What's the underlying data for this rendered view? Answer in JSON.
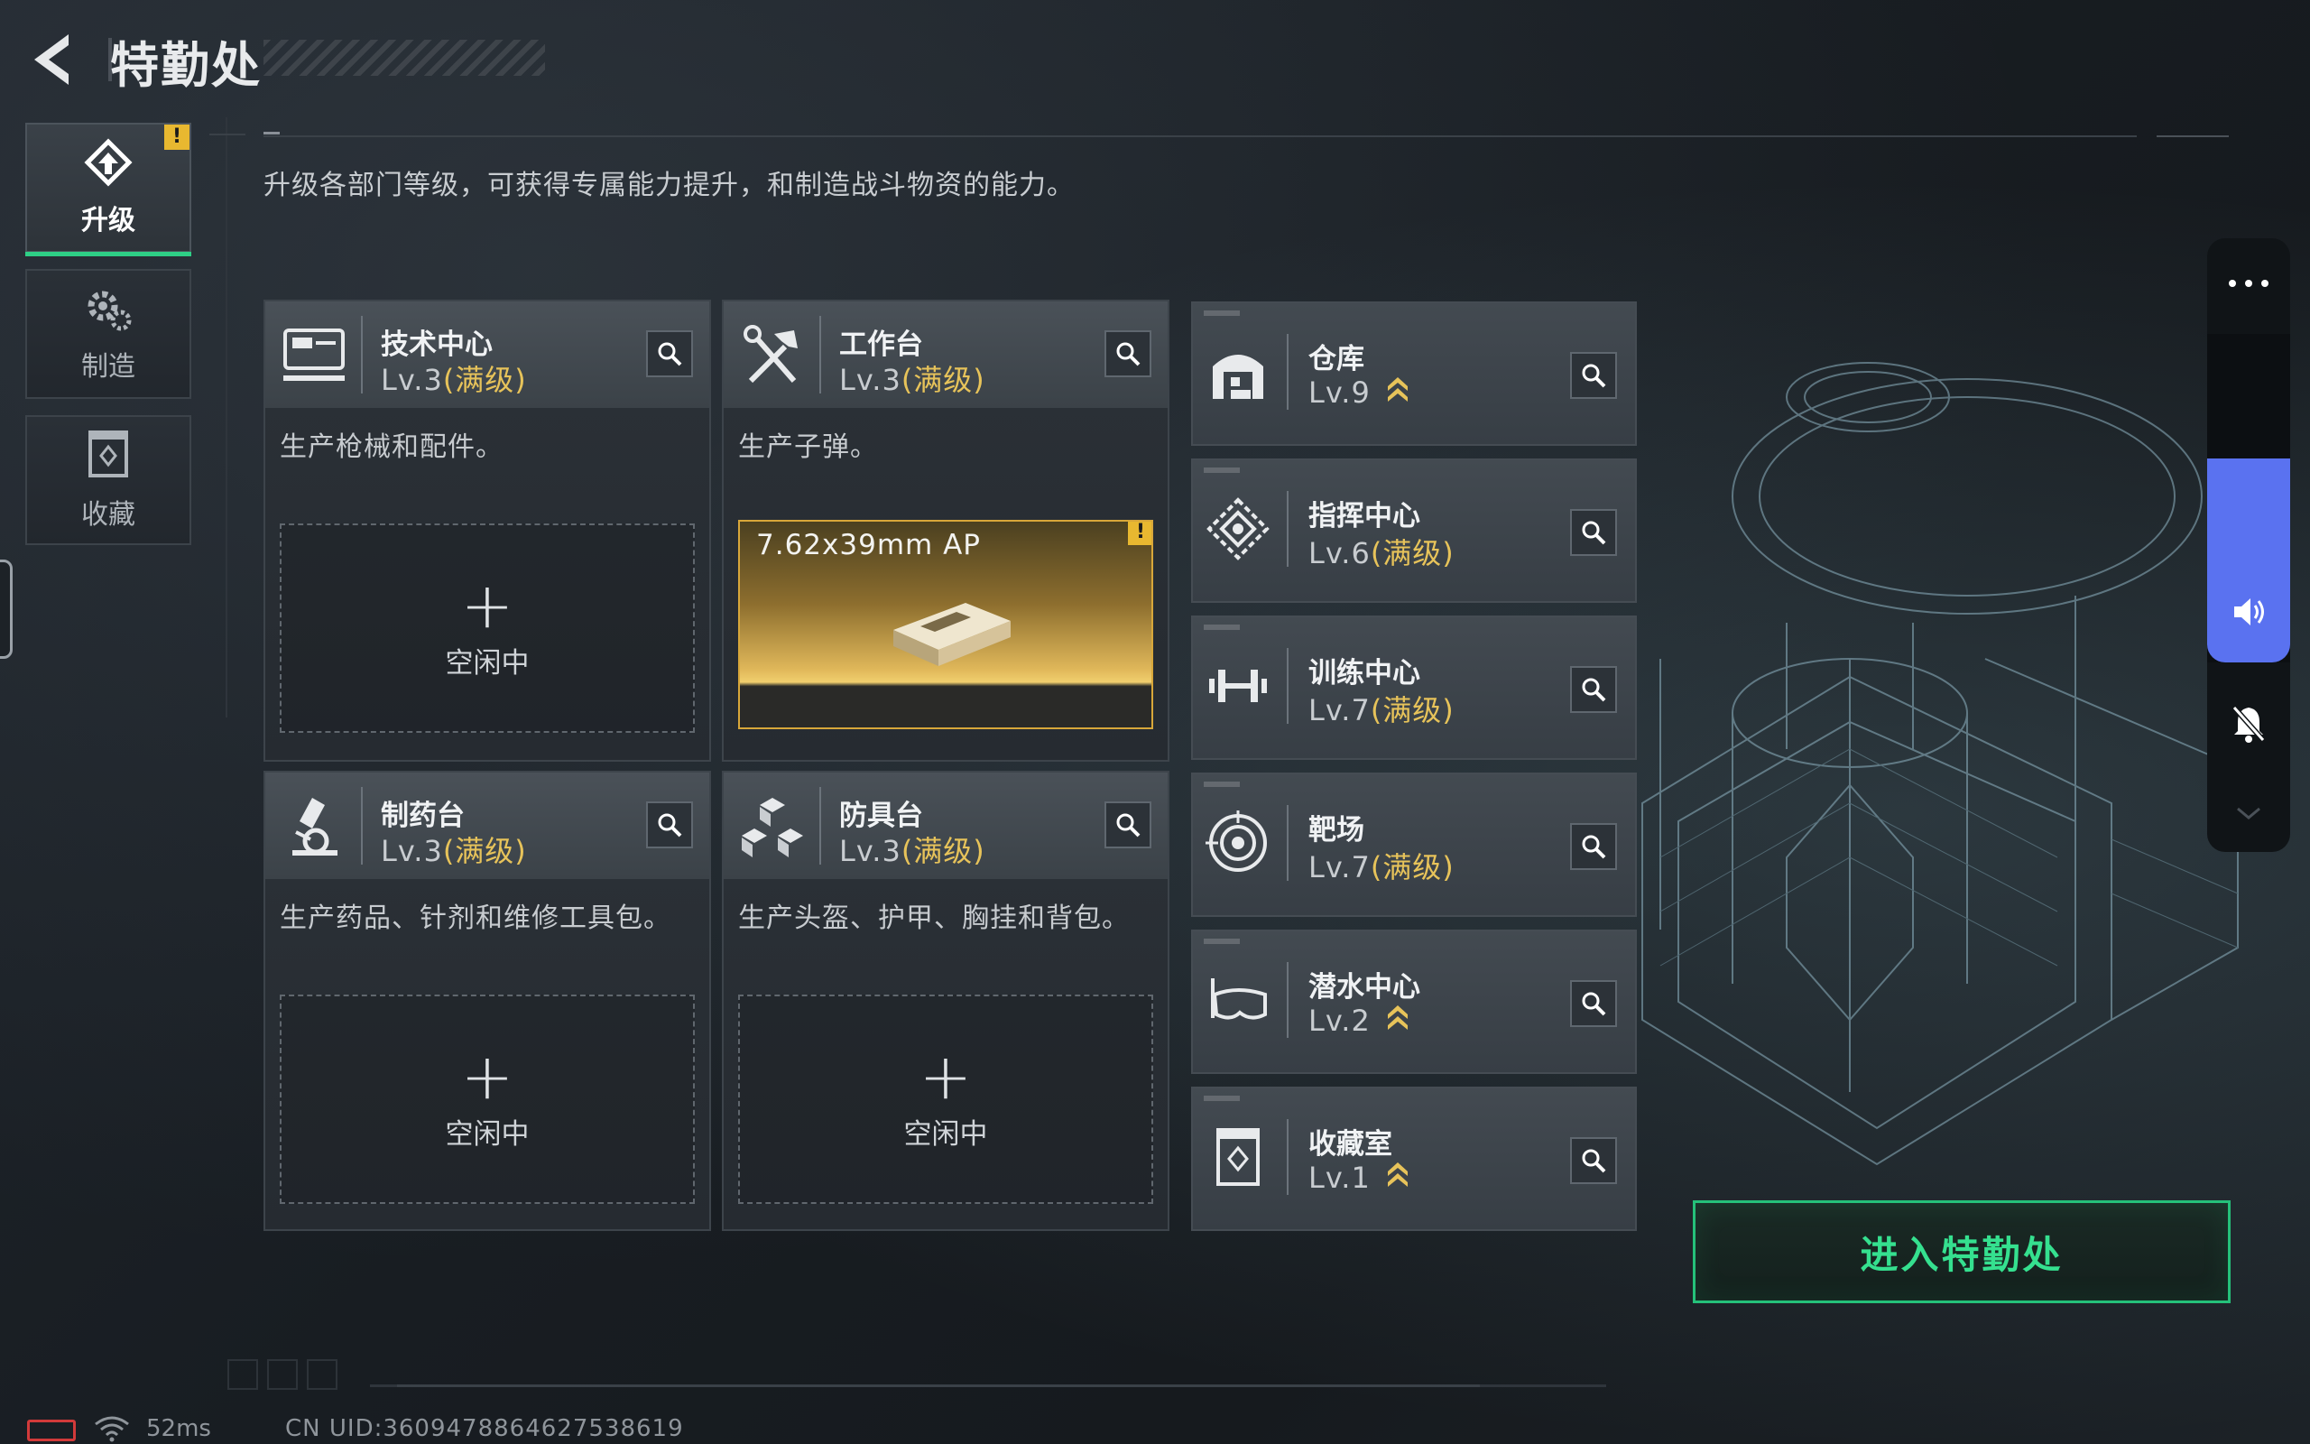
{
  "header": {
    "title": "特勤处",
    "subtitle": "升级各部门等级，可获得专属能力提升，和制造战斗物资的能力。"
  },
  "nav": [
    {
      "label": "升级",
      "active": true,
      "badge": "!"
    },
    {
      "label": "制造",
      "active": false
    },
    {
      "label": "收藏",
      "active": false
    }
  ],
  "production": {
    "tech_center": {
      "name": "技术中心",
      "level": "Lv.3",
      "max": "(满级)",
      "desc": "生产枪械和配件。",
      "slot_text": "空闲中"
    },
    "workbench": {
      "name": "工作台",
      "level": "Lv.3",
      "max": "(满级)",
      "desc": "生产子弹。",
      "item_name": "7.62x39mm AP",
      "item_badge": "!"
    },
    "pharmacy": {
      "name": "制药台",
      "level": "Lv.3",
      "max": "(满级)",
      "desc": "生产药品、针剂和维修工具包。",
      "slot_text": "空闲中"
    },
    "armor": {
      "name": "防具台",
      "level": "Lv.3",
      "max": "(满级)",
      "desc": "生产头盔、护甲、胸挂和背包。",
      "slot_text": "空闲中"
    }
  },
  "departments": [
    {
      "name": "仓库",
      "level": "Lv.9",
      "max": "",
      "upgradable": true,
      "icon": "warehouse-icon"
    },
    {
      "name": "指挥中心",
      "level": "Lv.6",
      "max": "(满级)",
      "upgradable": false,
      "icon": "command-icon"
    },
    {
      "name": "训练中心",
      "level": "Lv.7",
      "max": "(满级)",
      "upgradable": false,
      "icon": "dumbbell-icon"
    },
    {
      "name": "靶场",
      "level": "Lv.7",
      "max": "(满级)",
      "upgradable": false,
      "icon": "target-icon"
    },
    {
      "name": "潜水中心",
      "level": "Lv.2",
      "max": "",
      "upgradable": true,
      "icon": "diving-mask-icon"
    },
    {
      "name": "收藏室",
      "level": "Lv.1",
      "max": "",
      "upgradable": true,
      "icon": "collection-icon"
    }
  ],
  "enter_button": "进入特勤处",
  "side_controls": {
    "volume_level": 0.62
  },
  "status": {
    "ping": "52ms",
    "uid": "CN UID:3609478864627538619"
  },
  "colors": {
    "accent_green": "#2ecf86",
    "max_gold": "#e7c35a",
    "volume_blue": "#5a72f0",
    "battery_red": "#d23a3a"
  }
}
